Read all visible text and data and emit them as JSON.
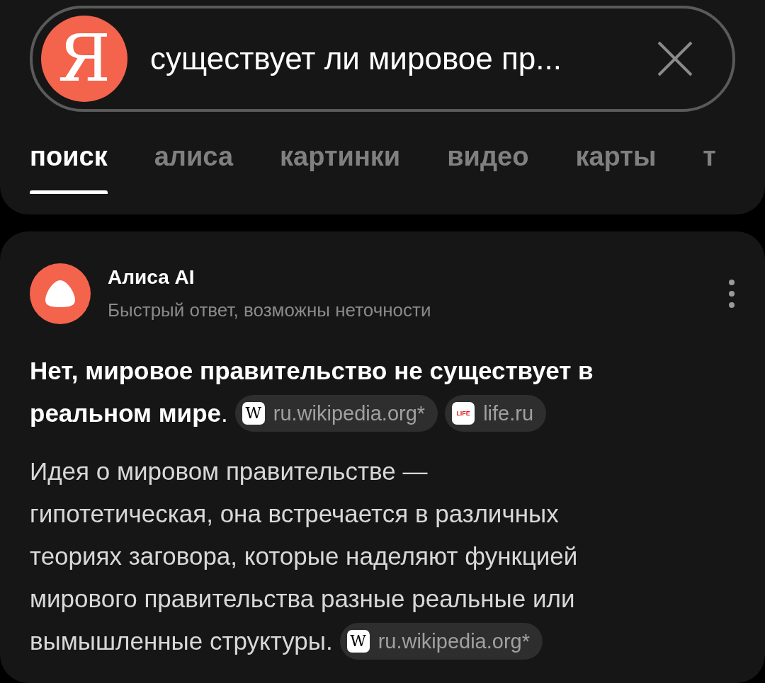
{
  "search": {
    "logo": "Я",
    "query": "существует ли мировое пр..."
  },
  "tabs": [
    {
      "label": "поиск",
      "selected": true
    },
    {
      "label": "алиса",
      "selected": false
    },
    {
      "label": "картинки",
      "selected": false
    },
    {
      "label": "видео",
      "selected": false
    },
    {
      "label": "карты",
      "selected": false
    },
    {
      "label": "т",
      "selected": false
    }
  ],
  "answer": {
    "author": "Алиса AI",
    "subtitle": "Быстрый ответ, возможны неточности",
    "paragraphs": [
      {
        "lines": [
          "**Нет, мировое правительство не существует в**",
          "**реальном мире**."
        ],
        "sources": [
          {
            "kind": "wiki",
            "icon": "W",
            "label": "ru.wikipedia.org*"
          },
          {
            "kind": "life",
            "icon": "LIFE",
            "label": "life.ru"
          }
        ]
      },
      {
        "lines": [
          "Идея о мировом правительстве —",
          "гипотетическая, она встречается в различных",
          "теориях заговора, которые наделяют функцией",
          "мирового правительства разные реальные или",
          "вымышленные структуры."
        ],
        "sources": [
          {
            "kind": "wiki",
            "icon": "W",
            "label": "ru.wikipedia.org*"
          }
        ]
      }
    ]
  }
}
